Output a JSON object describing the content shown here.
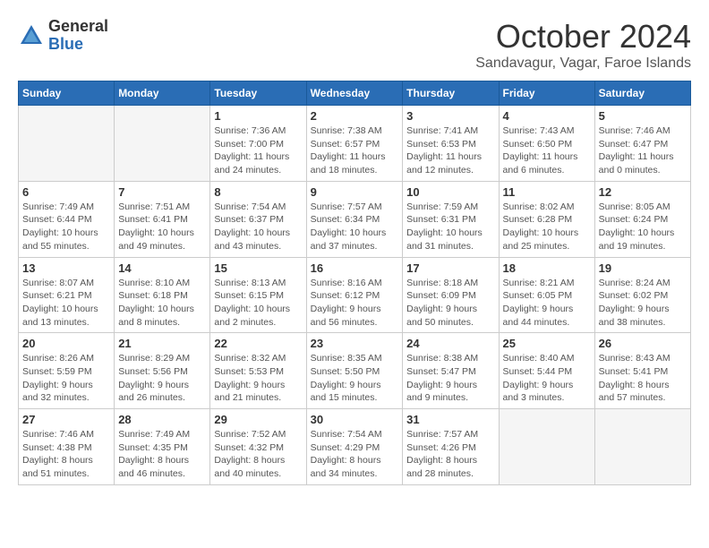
{
  "header": {
    "logo": {
      "general": "General",
      "blue": "Blue"
    },
    "title": "October 2024",
    "location": "Sandavagur, Vagar, Faroe Islands"
  },
  "weekdays": [
    "Sunday",
    "Monday",
    "Tuesday",
    "Wednesday",
    "Thursday",
    "Friday",
    "Saturday"
  ],
  "weeks": [
    [
      {
        "day": "",
        "info": ""
      },
      {
        "day": "",
        "info": ""
      },
      {
        "day": "1",
        "info": "Sunrise: 7:36 AM\nSunset: 7:00 PM\nDaylight: 11 hours and 24 minutes."
      },
      {
        "day": "2",
        "info": "Sunrise: 7:38 AM\nSunset: 6:57 PM\nDaylight: 11 hours and 18 minutes."
      },
      {
        "day": "3",
        "info": "Sunrise: 7:41 AM\nSunset: 6:53 PM\nDaylight: 11 hours and 12 minutes."
      },
      {
        "day": "4",
        "info": "Sunrise: 7:43 AM\nSunset: 6:50 PM\nDaylight: 11 hours and 6 minutes."
      },
      {
        "day": "5",
        "info": "Sunrise: 7:46 AM\nSunset: 6:47 PM\nDaylight: 11 hours and 0 minutes."
      }
    ],
    [
      {
        "day": "6",
        "info": "Sunrise: 7:49 AM\nSunset: 6:44 PM\nDaylight: 10 hours and 55 minutes."
      },
      {
        "day": "7",
        "info": "Sunrise: 7:51 AM\nSunset: 6:41 PM\nDaylight: 10 hours and 49 minutes."
      },
      {
        "day": "8",
        "info": "Sunrise: 7:54 AM\nSunset: 6:37 PM\nDaylight: 10 hours and 43 minutes."
      },
      {
        "day": "9",
        "info": "Sunrise: 7:57 AM\nSunset: 6:34 PM\nDaylight: 10 hours and 37 minutes."
      },
      {
        "day": "10",
        "info": "Sunrise: 7:59 AM\nSunset: 6:31 PM\nDaylight: 10 hours and 31 minutes."
      },
      {
        "day": "11",
        "info": "Sunrise: 8:02 AM\nSunset: 6:28 PM\nDaylight: 10 hours and 25 minutes."
      },
      {
        "day": "12",
        "info": "Sunrise: 8:05 AM\nSunset: 6:24 PM\nDaylight: 10 hours and 19 minutes."
      }
    ],
    [
      {
        "day": "13",
        "info": "Sunrise: 8:07 AM\nSunset: 6:21 PM\nDaylight: 10 hours and 13 minutes."
      },
      {
        "day": "14",
        "info": "Sunrise: 8:10 AM\nSunset: 6:18 PM\nDaylight: 10 hours and 8 minutes."
      },
      {
        "day": "15",
        "info": "Sunrise: 8:13 AM\nSunset: 6:15 PM\nDaylight: 10 hours and 2 minutes."
      },
      {
        "day": "16",
        "info": "Sunrise: 8:16 AM\nSunset: 6:12 PM\nDaylight: 9 hours and 56 minutes."
      },
      {
        "day": "17",
        "info": "Sunrise: 8:18 AM\nSunset: 6:09 PM\nDaylight: 9 hours and 50 minutes."
      },
      {
        "day": "18",
        "info": "Sunrise: 8:21 AM\nSunset: 6:05 PM\nDaylight: 9 hours and 44 minutes."
      },
      {
        "day": "19",
        "info": "Sunrise: 8:24 AM\nSunset: 6:02 PM\nDaylight: 9 hours and 38 minutes."
      }
    ],
    [
      {
        "day": "20",
        "info": "Sunrise: 8:26 AM\nSunset: 5:59 PM\nDaylight: 9 hours and 32 minutes."
      },
      {
        "day": "21",
        "info": "Sunrise: 8:29 AM\nSunset: 5:56 PM\nDaylight: 9 hours and 26 minutes."
      },
      {
        "day": "22",
        "info": "Sunrise: 8:32 AM\nSunset: 5:53 PM\nDaylight: 9 hours and 21 minutes."
      },
      {
        "day": "23",
        "info": "Sunrise: 8:35 AM\nSunset: 5:50 PM\nDaylight: 9 hours and 15 minutes."
      },
      {
        "day": "24",
        "info": "Sunrise: 8:38 AM\nSunset: 5:47 PM\nDaylight: 9 hours and 9 minutes."
      },
      {
        "day": "25",
        "info": "Sunrise: 8:40 AM\nSunset: 5:44 PM\nDaylight: 9 hours and 3 minutes."
      },
      {
        "day": "26",
        "info": "Sunrise: 8:43 AM\nSunset: 5:41 PM\nDaylight: 8 hours and 57 minutes."
      }
    ],
    [
      {
        "day": "27",
        "info": "Sunrise: 7:46 AM\nSunset: 4:38 PM\nDaylight: 8 hours and 51 minutes."
      },
      {
        "day": "28",
        "info": "Sunrise: 7:49 AM\nSunset: 4:35 PM\nDaylight: 8 hours and 46 minutes."
      },
      {
        "day": "29",
        "info": "Sunrise: 7:52 AM\nSunset: 4:32 PM\nDaylight: 8 hours and 40 minutes."
      },
      {
        "day": "30",
        "info": "Sunrise: 7:54 AM\nSunset: 4:29 PM\nDaylight: 8 hours and 34 minutes."
      },
      {
        "day": "31",
        "info": "Sunrise: 7:57 AM\nSunset: 4:26 PM\nDaylight: 8 hours and 28 minutes."
      },
      {
        "day": "",
        "info": ""
      },
      {
        "day": "",
        "info": ""
      }
    ]
  ]
}
